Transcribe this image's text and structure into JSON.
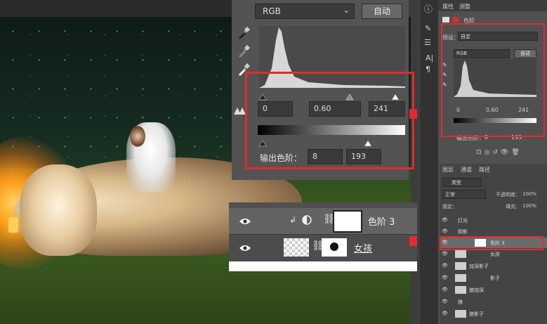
{
  "levels_panel": {
    "channel": "RGB",
    "auto_button": "自动",
    "input_black": "0",
    "input_gamma": "0.60",
    "input_white": "241",
    "output_label": "输出色阶：",
    "output_black": "8",
    "output_white": "193"
  },
  "layers_zoom": {
    "rows": [
      {
        "name": "色阶 3"
      },
      {
        "name": "女孩"
      }
    ]
  },
  "right_panel": {
    "tabs": [
      "属性",
      "调整"
    ],
    "adjust_title": "色阶",
    "preset_label": "预设：",
    "preset_value": "自定",
    "channel": "RGB",
    "auto_button": "自动",
    "input_black": "0",
    "input_gamma": "0.60",
    "input_white": "241",
    "output_label": "输出色阶：",
    "output_black": "8",
    "output_white": "193",
    "layer_tabs": [
      "图层",
      "通道",
      "路径"
    ],
    "filter_kind": "类型",
    "blend_mode": "正常",
    "opacity_label": "不透明度：",
    "opacity_value": "100%",
    "lock_label": "锁定：",
    "fill_label": "填充：",
    "fill_value": "100%",
    "layers": [
      {
        "name": "灯光",
        "type": "group"
      },
      {
        "name": "阴影",
        "type": "group"
      },
      {
        "name": "色阶 3",
        "type": "adjustment",
        "selected": true
      },
      {
        "name": "女孩",
        "type": "layer"
      },
      {
        "name": "加深影子",
        "type": "layer"
      },
      {
        "name": "影子",
        "type": "layer"
      },
      {
        "name": "狼加深",
        "type": "layer"
      },
      {
        "name": "狼",
        "type": "group"
      },
      {
        "name": "狼影子",
        "type": "layer"
      }
    ]
  },
  "colors": {
    "highlight_red": "#e32b2b",
    "panel_gray": "#535353",
    "selected_row": "#6b6b6b"
  }
}
